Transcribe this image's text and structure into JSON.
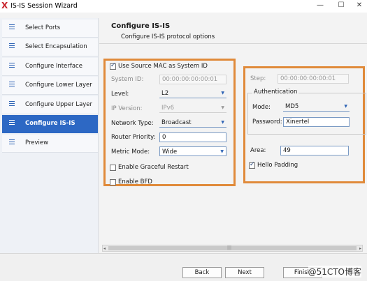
{
  "window": {
    "title": "IS-IS Session Wizard",
    "app_icon": "X",
    "minimize": "—",
    "maximize": "☐",
    "close": "✕"
  },
  "sidebar": {
    "items": [
      {
        "label": "Select Ports",
        "icon": "list-icon"
      },
      {
        "label": "Select Encapsulation",
        "icon": "list-icon"
      },
      {
        "label": "Configure Interface",
        "icon": "list-icon"
      },
      {
        "label": "Configure Lower Layer",
        "icon": "list-icon"
      },
      {
        "label": "Configure Upper Layer",
        "icon": "list-icon"
      },
      {
        "label": "Configure IS-IS",
        "icon": "list-icon",
        "active": true
      },
      {
        "label": "Preview",
        "icon": "list-icon"
      }
    ]
  },
  "header": {
    "title": "Configure IS-IS",
    "subtitle": "Configure IS-IS protocol options"
  },
  "left_panel": {
    "use_source_mac_label": "Use Source MAC as System ID",
    "use_source_mac_checked": true,
    "system_id_label": "System ID:",
    "system_id_value": "00:00:00:00:00:01",
    "level_label": "Level:",
    "level_value": "L2",
    "ip_version_label": "IP Version:",
    "ip_version_value": "IPv6",
    "network_type_label": "Network Type:",
    "network_type_value": "Broadcast",
    "router_priority_label": "Router Priority:",
    "router_priority_value": "0",
    "metric_mode_label": "Metric Mode:",
    "metric_mode_value": "Wide",
    "graceful_restart_label": "Enable Graceful Restart",
    "graceful_restart_checked": false,
    "bfd_label": "Enable BFD",
    "bfd_checked": false
  },
  "right_panel": {
    "step_label": "Step:",
    "step_value": "00:00:00:00:00:01",
    "auth_group_title": "Authentication",
    "mode_label": "Mode:",
    "mode_value": "MD5",
    "password_label": "Password:",
    "password_value": "Xinertel",
    "area_label": "Area:",
    "area_value": "49",
    "hello_padding_label": "Hello Padding",
    "hello_padding_checked": true
  },
  "scrollbar": {
    "left_arrow": "◂",
    "right_arrow": "▸",
    "grip": "|||"
  },
  "footer": {
    "back_label": "Back",
    "next_label": "Next",
    "finish_label": "Finish",
    "watermark": "@51CTO博客"
  },
  "colors": {
    "accent": "#2d68c4",
    "highlight_border": "#e08a3a"
  }
}
